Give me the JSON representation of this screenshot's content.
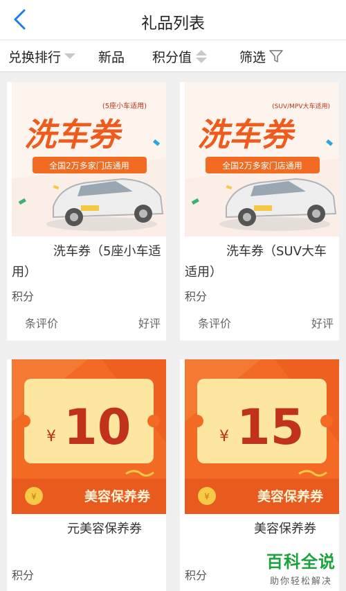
{
  "header": {
    "title": "礼品列表"
  },
  "filters": {
    "rank": "兑换排行",
    "new": "新品",
    "points": "积分值",
    "screen": "筛选"
  },
  "cards": [
    {
      "name": "洗车券（5座小车适用）",
      "points_label": "积分",
      "reviews_label": "条评价",
      "good_label": "好评",
      "image": {
        "headline": "洗车券",
        "tag": "(5座小车适用)",
        "banner": "全国2万多家门店通用"
      }
    },
    {
      "name": "洗车券（SUV大车适用）",
      "points_label": "积分",
      "reviews_label": "条评价",
      "good_label": "好评",
      "image": {
        "headline": "洗车券",
        "tag": "(SUV/MPV大车适用)",
        "banner": "全国2万多家门店通用"
      }
    },
    {
      "name": "元美容保养券",
      "points_label": "积分",
      "image": {
        "currency": "¥",
        "amount": "10",
        "label": "美容保养券",
        "coin": "¥"
      }
    },
    {
      "name": "美容保养券",
      "points_label": "积分",
      "image": {
        "currency": "¥",
        "amount": "15",
        "label": "美容保养券",
        "coin": "¥"
      }
    }
  ],
  "watermark": {
    "title": "百科全说",
    "subtitle": "助你轻松解决"
  },
  "colors": {
    "accent": "#1a7fe0",
    "orange": "#ee5a24",
    "cream": "#fde7a0",
    "red": "#c0321c"
  }
}
